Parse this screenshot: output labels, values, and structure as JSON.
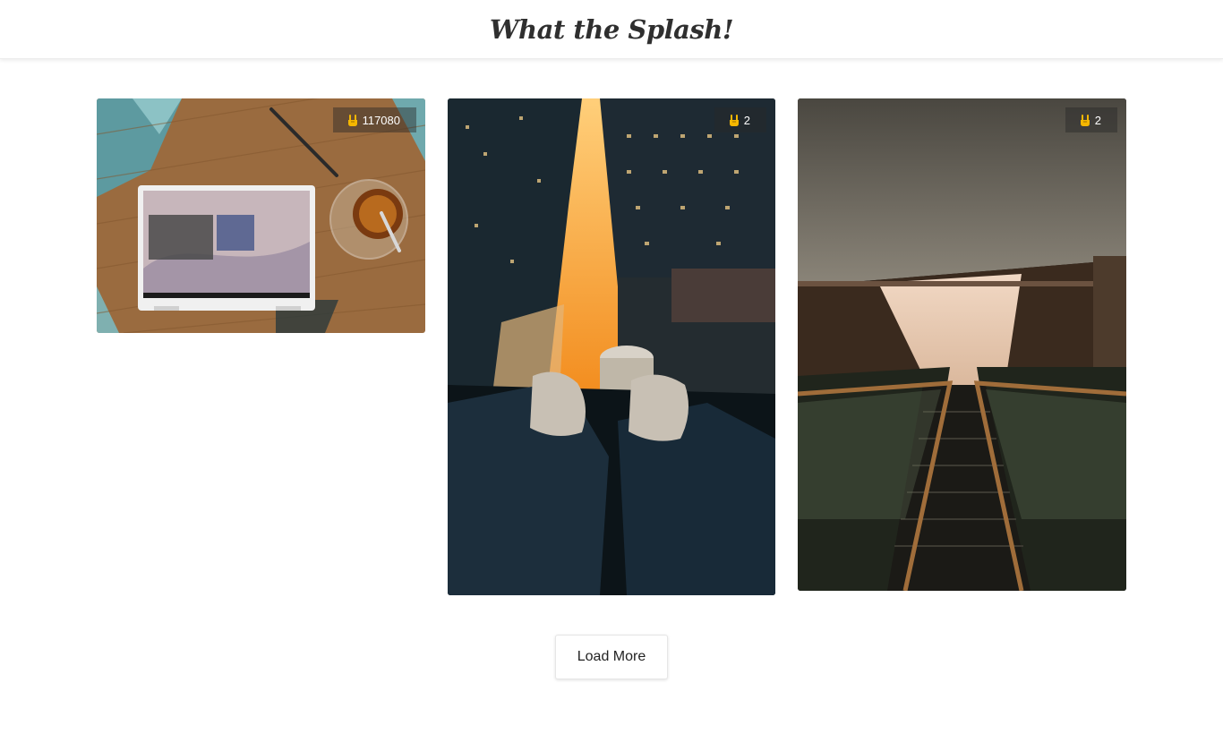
{
  "header": {
    "title": "What the Splash!"
  },
  "photos": [
    {
      "alt": "Laptop with calendar on wooden desk next to a cup of tea",
      "likes": "117080"
    },
    {
      "alt": "Feet dangling over a skyscraper edge above a lit city street",
      "likes": "2"
    },
    {
      "alt": "Looking down an escalator into a subway station",
      "likes": "2"
    }
  ],
  "actions": {
    "load_more_label": "Load More"
  },
  "colors": {
    "like_icon": "#f5b700",
    "title_text": "#2f2f2f"
  },
  "icons": {
    "likes": "rock-hand-icon"
  }
}
